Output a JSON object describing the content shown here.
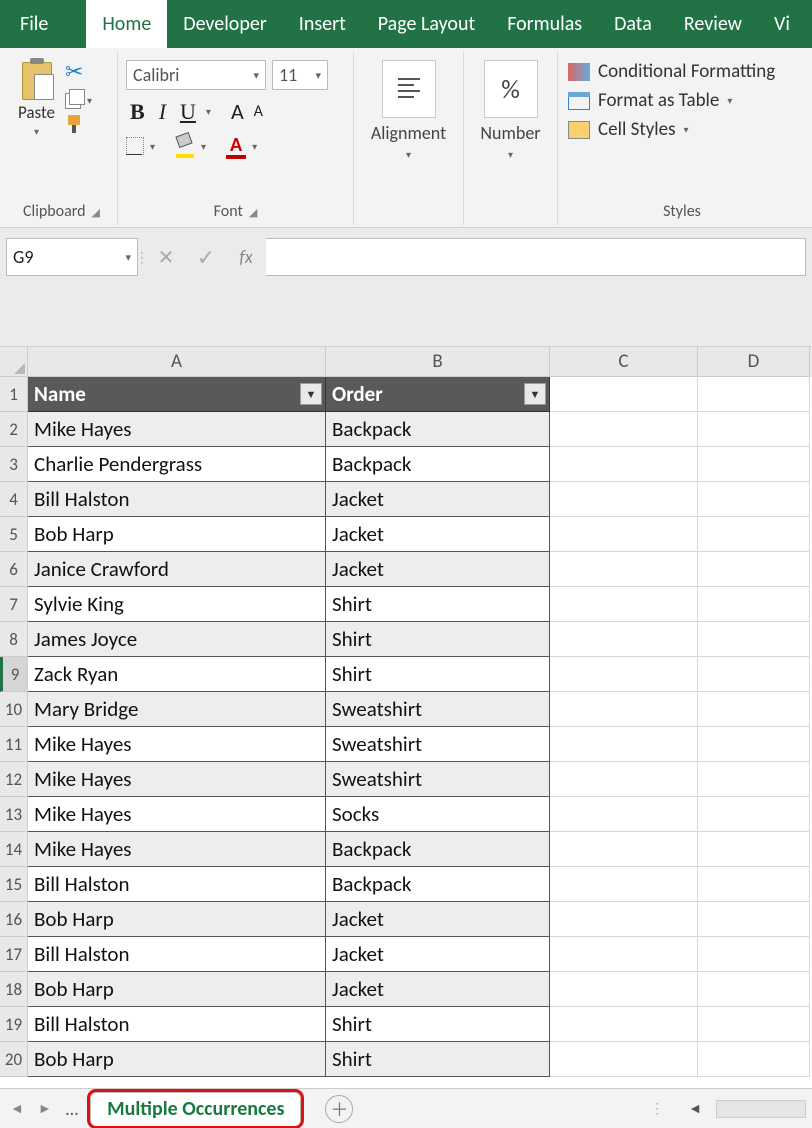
{
  "tabs": {
    "file": "File",
    "home": "Home",
    "developer": "Developer",
    "insert": "Insert",
    "pageLayout": "Page Layout",
    "formulas": "Formulas",
    "data": "Data",
    "review": "Review",
    "view": "Vi"
  },
  "ribbon": {
    "clipboard": {
      "label": "Clipboard",
      "paste": "Paste"
    },
    "font": {
      "label": "Font",
      "name": "Calibri",
      "size": "11"
    },
    "alignment": {
      "label": "Alignment"
    },
    "number": {
      "label": "Number"
    },
    "styles": {
      "label": "Styles",
      "conditional": "Conditional Formatting",
      "table": "Format as Table",
      "cell": "Cell Styles"
    }
  },
  "formulaBar": {
    "nameBox": "G9",
    "formula": ""
  },
  "columns": [
    "A",
    "B",
    "C",
    "D"
  ],
  "tableHeaders": {
    "a": "Name",
    "b": "Order"
  },
  "rows": [
    {
      "n": "1"
    },
    {
      "n": "2",
      "a": "Mike Hayes",
      "b": "Backpack",
      "band": true
    },
    {
      "n": "3",
      "a": "Charlie Pendergrass",
      "b": "Backpack",
      "band": false
    },
    {
      "n": "4",
      "a": "Bill Halston",
      "b": "Jacket",
      "band": true
    },
    {
      "n": "5",
      "a": "Bob Harp",
      "b": "Jacket",
      "band": false
    },
    {
      "n": "6",
      "a": "Janice Crawford",
      "b": "Jacket",
      "band": true
    },
    {
      "n": "7",
      "a": "Sylvie King",
      "b": "Shirt",
      "band": false
    },
    {
      "n": "8",
      "a": "James Joyce",
      "b": "Shirt",
      "band": true
    },
    {
      "n": "9",
      "a": "Zack Ryan",
      "b": "Shirt",
      "band": false,
      "sel": true
    },
    {
      "n": "10",
      "a": "Mary Bridge",
      "b": "Sweatshirt",
      "band": true
    },
    {
      "n": "11",
      "a": "Mike Hayes",
      "b": "Sweatshirt",
      "band": false
    },
    {
      "n": "12",
      "a": "Mike Hayes",
      "b": "Sweatshirt",
      "band": true
    },
    {
      "n": "13",
      "a": "Mike Hayes",
      "b": "Socks",
      "band": false
    },
    {
      "n": "14",
      "a": "Mike Hayes",
      "b": "Backpack",
      "band": true
    },
    {
      "n": "15",
      "a": "Bill Halston",
      "b": "Backpack",
      "band": false
    },
    {
      "n": "16",
      "a": "Bob Harp",
      "b": "Jacket",
      "band": true
    },
    {
      "n": "17",
      "a": "Bill Halston",
      "b": "Jacket",
      "band": false
    },
    {
      "n": "18",
      "a": "Bob Harp",
      "b": "Jacket",
      "band": true
    },
    {
      "n": "19",
      "a": "Bill Halston",
      "b": "Shirt",
      "band": false
    },
    {
      "n": "20",
      "a": "Bob Harp",
      "b": "Shirt",
      "band": true
    }
  ],
  "sheetBar": {
    "activeTab": "Multiple Occurrences"
  }
}
